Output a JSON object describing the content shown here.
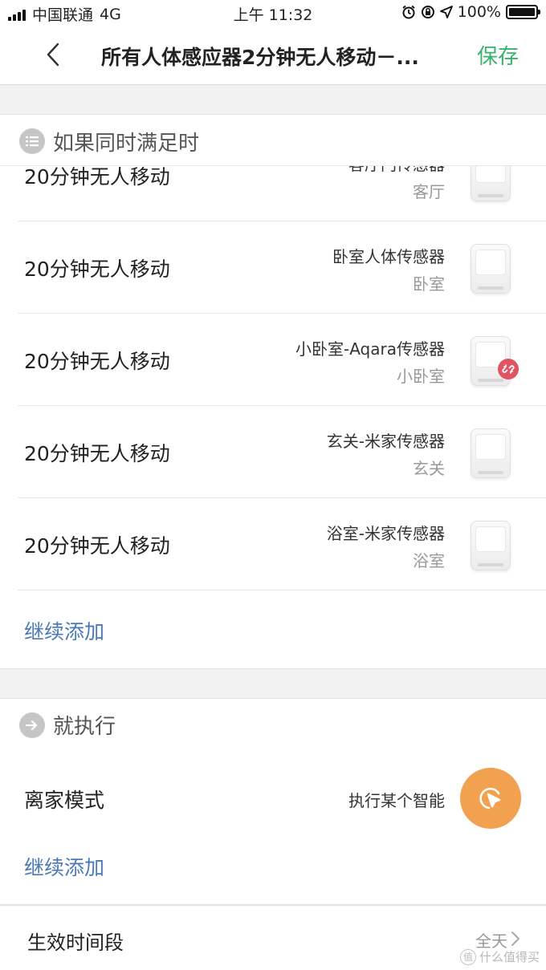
{
  "status_bar": {
    "carrier": "中国联通",
    "network": "4G",
    "time": "上午 11:32",
    "battery": "100%"
  },
  "nav": {
    "title": "所有人体感应器2分钟无人移动－...",
    "save_label": "保存"
  },
  "conditions": {
    "header": "如果同时满足时",
    "items": [
      {
        "label": "20分钟无人移动",
        "device": "客厅门传感器",
        "room": "客厅"
      },
      {
        "label": "20分钟无人移动",
        "device": "卧室人体传感器",
        "room": "卧室"
      },
      {
        "label": "20分钟无人移动",
        "device": "小卧室-Aqara传感器",
        "room": "小卧室"
      },
      {
        "label": "20分钟无人移动",
        "device": "玄关-米家传感器",
        "room": "玄关"
      },
      {
        "label": "20分钟无人移动",
        "device": "浴室-米家传感器",
        "room": "浴室"
      }
    ],
    "add_label": "继续添加"
  },
  "actions": {
    "header": "就执行",
    "items": [
      {
        "label": "离家模式",
        "type": "执行某个智能"
      }
    ],
    "add_label": "继续添加"
  },
  "time_period": {
    "label": "生效时间段",
    "value": "全天"
  },
  "watermark": {
    "badge": "值",
    "text": "什么值得买"
  },
  "colors": {
    "accent_green": "#36b46c",
    "link_blue": "#4a79b7",
    "action_orange": "#f2a150",
    "offline_red": "#e05360"
  }
}
